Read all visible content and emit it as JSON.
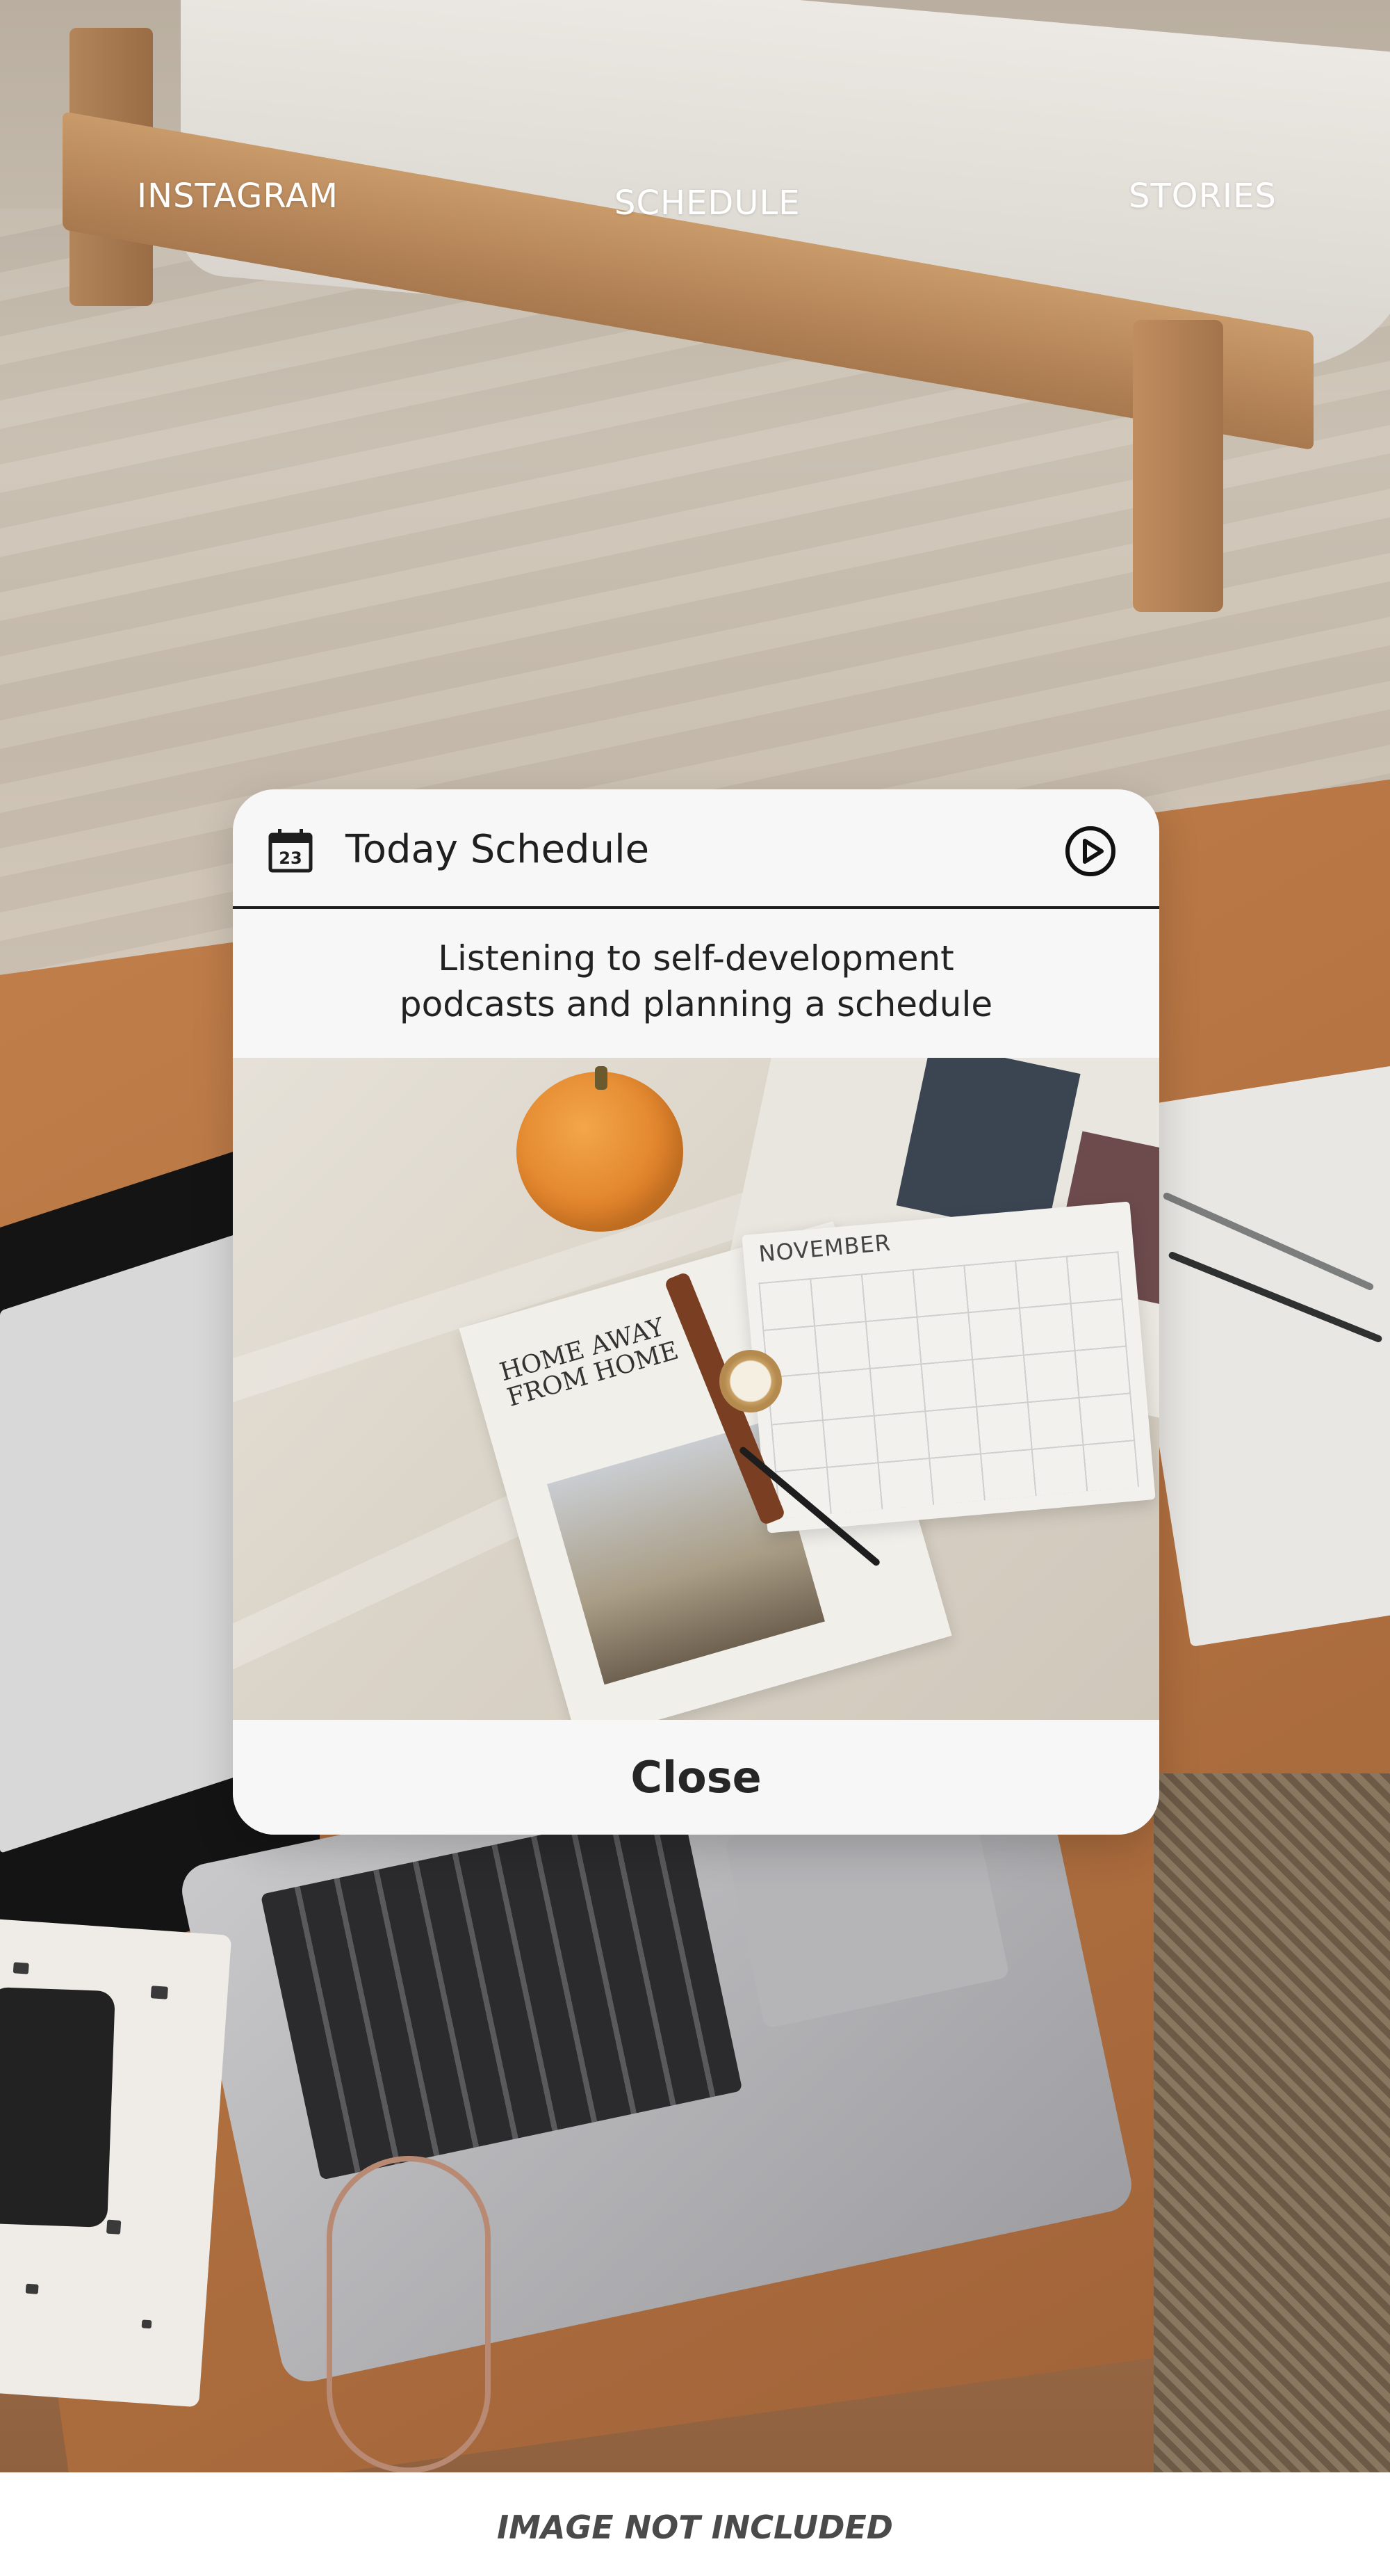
{
  "nav": {
    "items": [
      {
        "label": "INSTAGRAM"
      },
      {
        "label": "SCHEDULE"
      },
      {
        "label": "STORIES"
      }
    ]
  },
  "dialog": {
    "icon": "calendar-icon",
    "calendar_day": "23",
    "title": "Today Schedule",
    "action_icon": "play-circle-icon",
    "description_lines": [
      "Listening to self-development",
      "podcasts and planning a schedule"
    ],
    "photo": {
      "magazine_headline_lines": [
        "HOME AWAY",
        "FROM HOME"
      ],
      "planner_month": "NOVEMBER"
    },
    "close_label": "Close"
  },
  "footer": {
    "label": "IMAGE NOT INCLUDED"
  },
  "colors": {
    "dialog_bg": "#f7f7f7",
    "nav_text": "#ffffff",
    "divider": "#1d1d1d"
  }
}
